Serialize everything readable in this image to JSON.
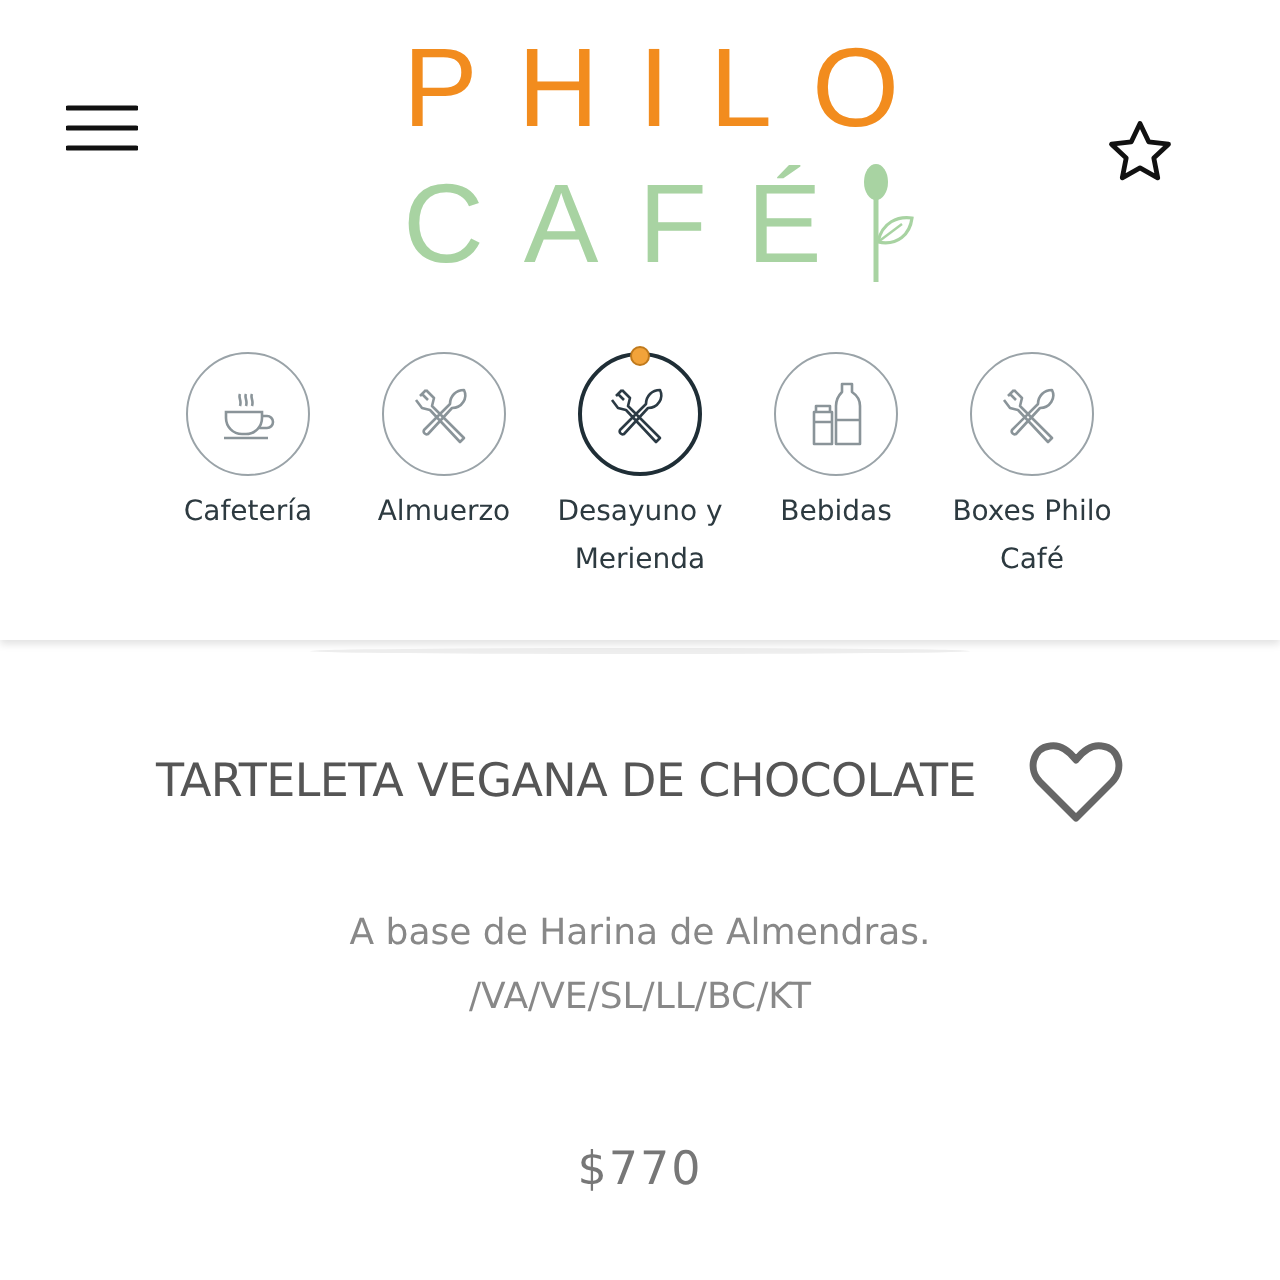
{
  "logo": {
    "line_1": "PHILO",
    "line_2": "CAFÉ"
  },
  "categories": [
    {
      "label": "Cafetería",
      "kind": "cup",
      "selected": false
    },
    {
      "label": "Almuerzo",
      "kind": "cutlery",
      "selected": false
    },
    {
      "label": "Desayuno y Merienda",
      "kind": "cutlery",
      "selected": true
    },
    {
      "label": "Bebidas",
      "kind": "bottles",
      "selected": false
    },
    {
      "label": "Boxes Philo Café",
      "kind": "cutlery",
      "selected": false
    }
  ],
  "product": {
    "name": "TARTELETA VEGANA DE CHOCOLATE",
    "description": "A base de Harina de Almendras. /VA/VE/SL/LL/BC/KT",
    "price": "$770"
  }
}
